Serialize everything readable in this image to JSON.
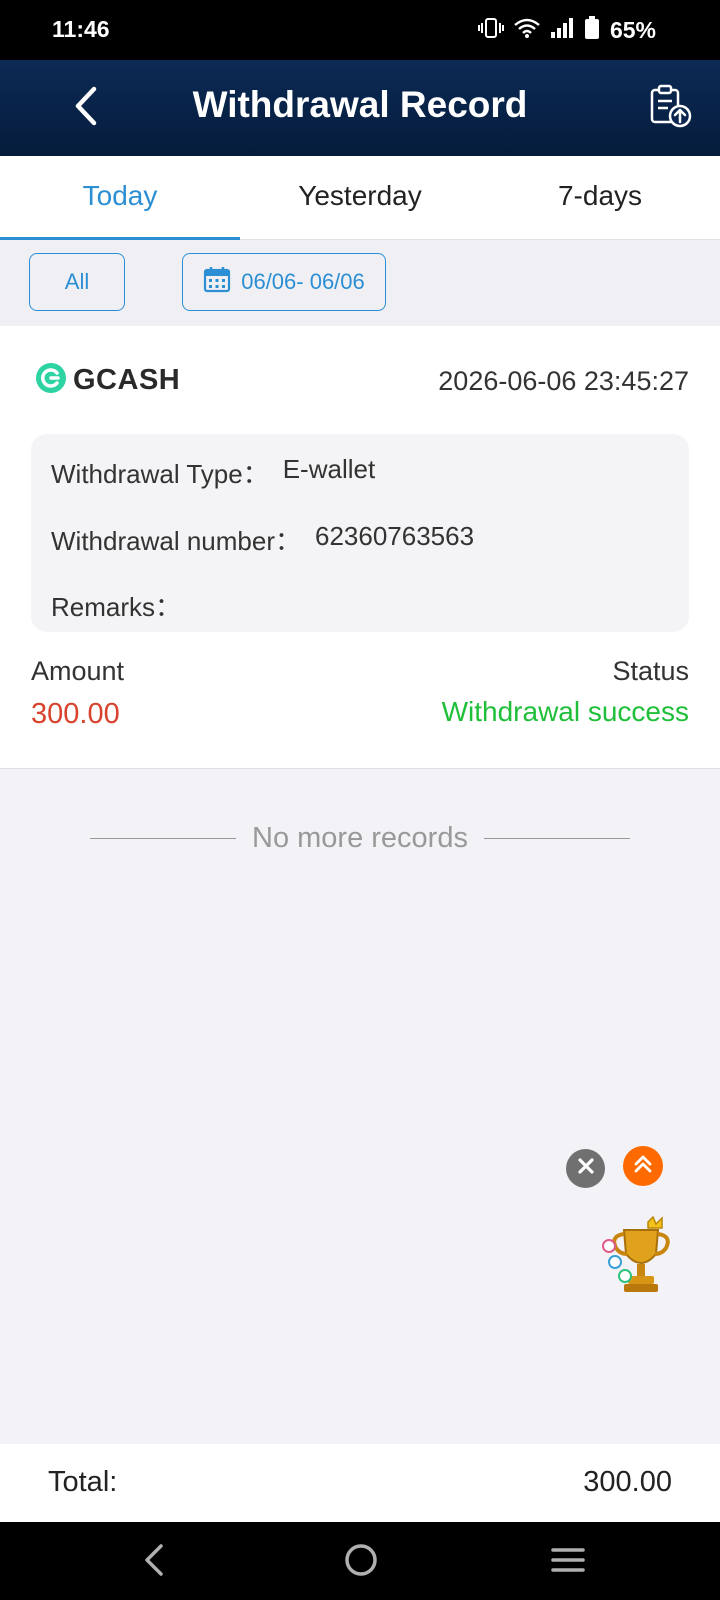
{
  "status_bar": {
    "time": "11:46",
    "battery": "65%",
    "icons": [
      "vibrate-icon",
      "wifi-icon",
      "signal-icon",
      "battery-icon"
    ]
  },
  "header": {
    "title": "Withdrawal Record",
    "back_icon": "chevron-left-icon",
    "action_icon": "clipboard-upload-icon"
  },
  "tabs": [
    {
      "label": "Today",
      "active": true
    },
    {
      "label": "Yesterday",
      "active": false
    },
    {
      "label": "7-days",
      "active": false
    }
  ],
  "filters": {
    "type_label": "All",
    "date_range": "06/06- 06/06",
    "date_icon": "calendar-icon"
  },
  "record": {
    "provider": "GCASH",
    "datetime": "2026-06-06 23:45:27",
    "type_label": "Withdrawal Type：",
    "type_value": "E-wallet",
    "number_label": "Withdrawal number：",
    "number_value": "62360763563",
    "remarks_label": "Remarks：",
    "remarks_value": "",
    "amount_label": "Amount",
    "amount_value": "300.00",
    "status_label": "Status",
    "status_value": "Withdrawal success"
  },
  "list_end_text": "No more records",
  "footer": {
    "total_label": "Total:",
    "total_value": "300.00"
  },
  "colors": {
    "accent": "#2c8fd4",
    "header_bg": "#0a2550",
    "amount": "#d8432e",
    "success": "#1fbf3a",
    "float_top": "#ff6a00"
  }
}
